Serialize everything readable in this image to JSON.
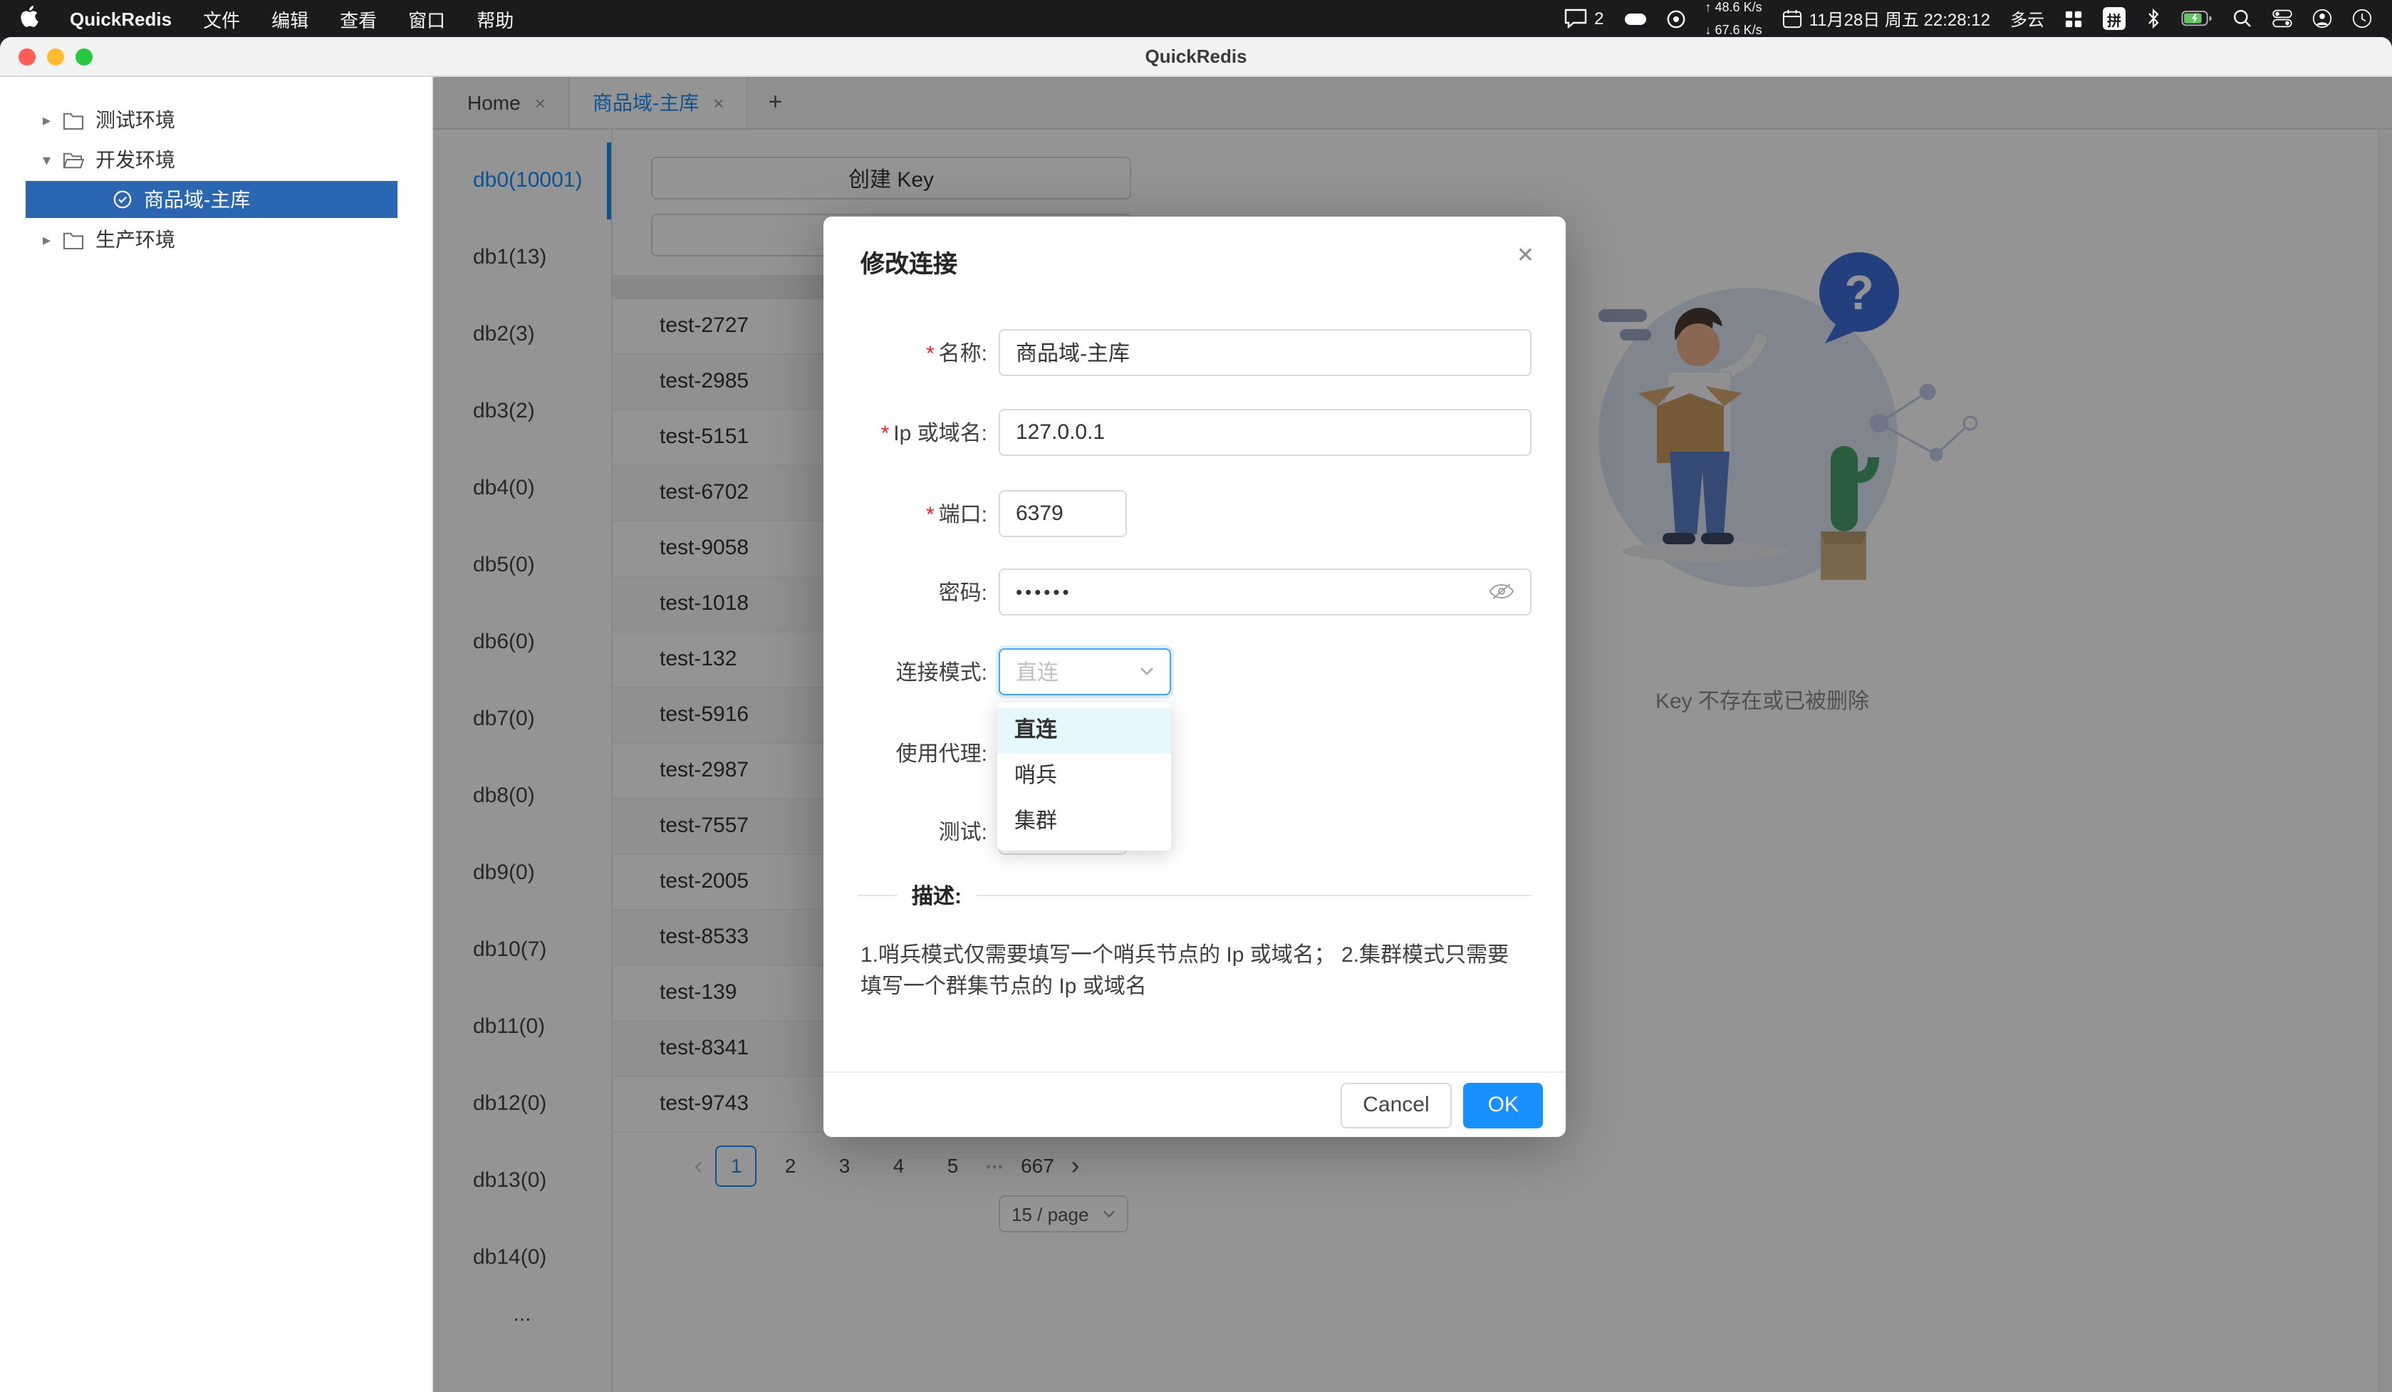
{
  "menu_bar": {
    "app_name": "QuickRedis",
    "menus": [
      "文件",
      "编辑",
      "查看",
      "窗口",
      "帮助"
    ],
    "status": {
      "chat_count": "2",
      "net_up": "48.6 K/s",
      "net_down": "67.6 K/s",
      "date": "11月28日 周五 22:28:12",
      "weather": "多云",
      "input_method": "拼"
    }
  },
  "window": {
    "title": "QuickRedis"
  },
  "sidebar": {
    "test_env": "测试环境",
    "dev_env": "开发环境",
    "selected_conn": "商品域-主库",
    "prod_env": "生产环境"
  },
  "tabs": {
    "home": "Home",
    "active": "商品域-主库"
  },
  "db_list": [
    "db0(10001)",
    "db1(13)",
    "db2(3)",
    "db3(2)",
    "db4(0)",
    "db5(0)",
    "db6(0)",
    "db7(0)",
    "db8(0)",
    "db9(0)",
    "db10(7)",
    "db11(0)",
    "db12(0)",
    "db13(0)",
    "db14(0)"
  ],
  "db_more": "...",
  "keys_panel": {
    "create_button": "创建 Key",
    "keys": [
      "test-2727",
      "test-2985",
      "test-5151",
      "test-6702",
      "test-9058",
      "test-1018",
      "test-132",
      "test-5916",
      "test-2987",
      "test-7557",
      "test-2005",
      "test-8533",
      "test-139",
      "test-8341",
      "test-9743"
    ],
    "pagination": {
      "pages": [
        "1",
        "2",
        "3",
        "4",
        "5"
      ],
      "last": "667",
      "page_size": "15 / page"
    }
  },
  "empty_state": {
    "text": "Key 不存在或已被删除"
  },
  "modal": {
    "title": "修改连接",
    "name_label": "名称:",
    "name_value": "商品域-主库",
    "ip_label": "Ip 或域名:",
    "ip_value": "127.0.0.1",
    "port_label": "端口:",
    "port_value": "6379",
    "password_label": "密码:",
    "password_value": "••••••",
    "mode_label": "连接模式:",
    "mode_value": "直连",
    "proxy_label": "使用代理:",
    "test_label": "测试:",
    "options": [
      "直连",
      "哨兵",
      "集群"
    ],
    "divider": "描述:",
    "description": "1.哨兵模式仅需要填写一个哨兵节点的 Ip 或域名； 2.集群模式只需要填写一个群集节点的 Ip 或域名",
    "cancel": "Cancel",
    "ok": "OK"
  },
  "icons": {
    "caret_right": "▸",
    "caret_down": "▾",
    "close": "✕",
    "tab_close": "×",
    "plus": "+",
    "prev": "‹",
    "next": "›",
    "ellipsis": "•••",
    "up": "↑",
    "down": "↓",
    "required": "*"
  },
  "colors": {
    "accent": "#1890ff",
    "selected_tree": "#2a66b2",
    "mask": "rgba(0,0,0,0.42)"
  }
}
